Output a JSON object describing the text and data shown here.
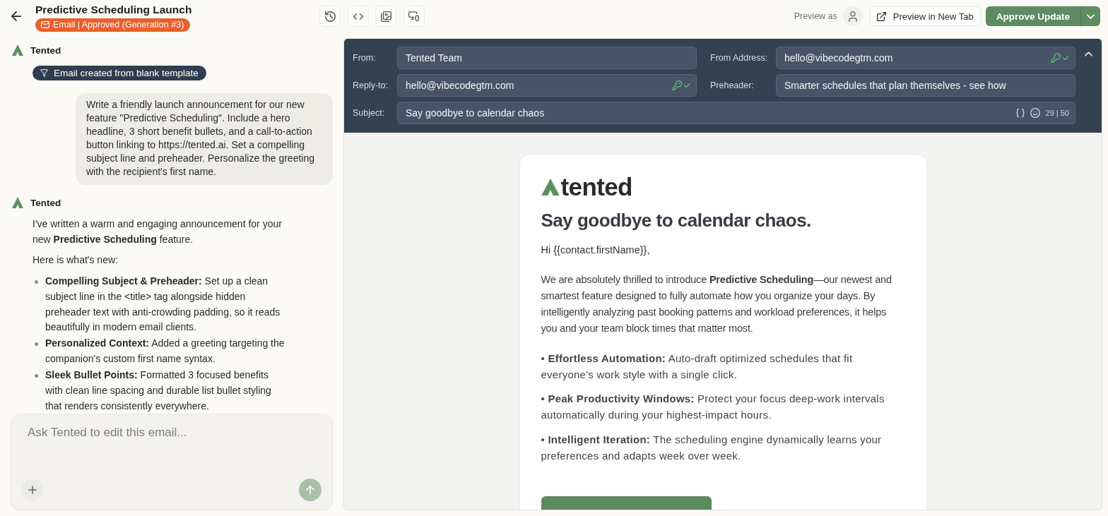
{
  "header": {
    "title": "Predictive Scheduling Launch",
    "badge": "Email | Approved (Generation #3)",
    "preview_as": "Preview as",
    "preview_button": "Preview in New Tab",
    "approve_button": "Approve Update"
  },
  "chat": {
    "items": [
      {
        "kind": "sender",
        "name": "Tented"
      },
      {
        "kind": "event",
        "text": "Email created from blank template"
      },
      {
        "kind": "user",
        "text": "Write a friendly launch announcement for our new feature \"Predictive Scheduling\". Include a hero headline, 3 short benefit bullets, and a call-to-action button linking to https://tented.ai. Set a compelling subject line and preheader. Personalize the greeting with the recipient's first name."
      },
      {
        "kind": "sender",
        "name": "Tented"
      },
      {
        "kind": "reply",
        "paragraphs": [
          "I've written a warm and engaging announcement for your new **Predictive Scheduling** feature.",
          "Here is what's new:"
        ],
        "bullets": [
          "**Compelling Subject & Preheader:** Set up a clean subject line in the <title> tag alongside hidden preheader text with anti-crowding padding, so it reads beautifully in modern email clients.",
          "**Personalized Context:** Added a greeting targeting the companion's custom first name syntax.",
          "**Sleek Bullet Points:** Formatted 3 focused benefits with clean line spacing and durable list bullet styling that renders consistently everywhere."
        ]
      }
    ],
    "composer": {
      "placeholder": "Ask Tented to edit this email..."
    }
  },
  "email_settings": {
    "expanded": true,
    "fields": [
      {
        "label": "From:",
        "value": "Tented Team",
        "verified": false
      },
      {
        "label": "From Address:",
        "value": "hello@vibecodegtm.com",
        "verified": true
      },
      {
        "label": "Reply-to:",
        "value": "hello@vibecodegtm.com",
        "verified": true
      },
      {
        "label": "Preheader:",
        "value": "Smarter schedules that plan themselves - see how",
        "verified": false
      }
    ],
    "subject": {
      "label": "Subject:",
      "value": "Say goodbye to calendar chaos",
      "counter": "29 | 50"
    }
  },
  "email_preview": {
    "logo_text": "tented",
    "headline": "Say goodbye to calendar chaos.",
    "greeting": "Hi {{contact.firstName}},",
    "intro": "We are absolutely thrilled to introduce **Predictive Scheduling**—our newest and smartest feature designed to fully automate how you organize your days. By intelligently analyzing past booking patterns and workload preferences, it helps you and your team block times that matter most.",
    "benefits": [
      "• **Effortless Automation:** Auto-draft optimized schedules that fit everyone's work style with a single click.",
      "• **Peak Productivity Windows:** Protect your focus deep-work intervals automatically during your highest-impact hours.",
      "• **Intelligent Iteration:** The scheduling engine dynamically learns your preferences and adapts week over week."
    ]
  }
}
